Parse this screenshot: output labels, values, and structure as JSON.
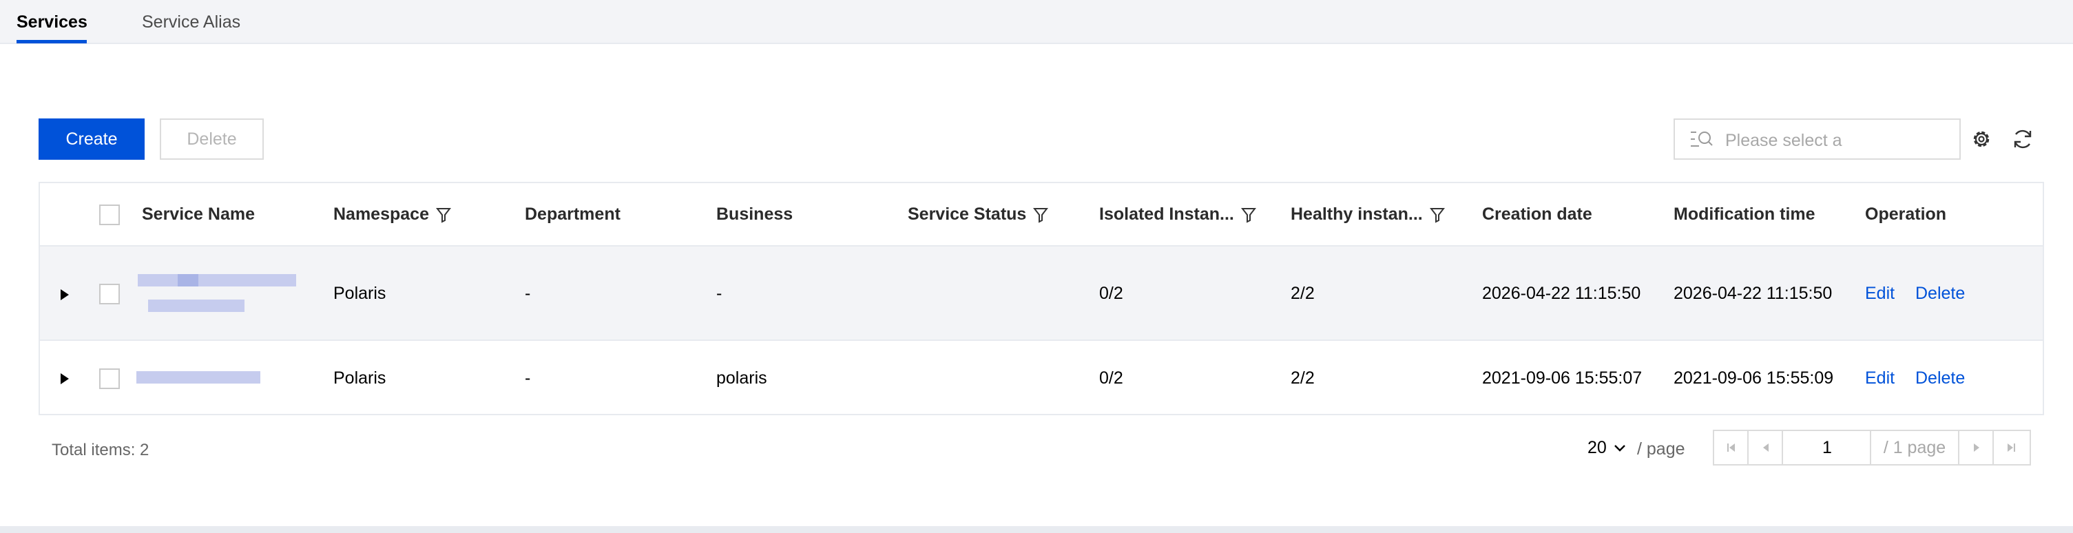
{
  "tabs": [
    {
      "label": "Services",
      "active": true
    },
    {
      "label": "Service Alias",
      "active": false
    }
  ],
  "toolbar": {
    "create_label": "Create",
    "delete_label": "Delete",
    "search_placeholder": "Please select a",
    "icons": [
      "search-icon",
      "gear-icon",
      "refresh-icon"
    ]
  },
  "table": {
    "columns": [
      {
        "label": "Service Name",
        "filter": false
      },
      {
        "label": "Namespace",
        "filter": true
      },
      {
        "label": "Department",
        "filter": false
      },
      {
        "label": "Business",
        "filter": false
      },
      {
        "label": "Service Status",
        "filter": true
      },
      {
        "label": "Isolated Instan...",
        "filter": true
      },
      {
        "label": "Healthy instan...",
        "filter": true
      },
      {
        "label": "Creation date",
        "filter": false
      },
      {
        "label": "Modification time",
        "filter": false
      },
      {
        "label": "Operation",
        "filter": false
      }
    ],
    "rows": [
      {
        "service_name": "",
        "namespace": "Polaris",
        "department": "-",
        "business": "-",
        "service_status": "",
        "isolated_instances": "0/2",
        "healthy_instances": "2/2",
        "creation_date": "2026-04-22 11:15:50",
        "modification_time": "2026-04-22 11:15:50",
        "edit_label": "Edit",
        "delete_label": "Delete"
      },
      {
        "service_name": "",
        "namespace": "Polaris",
        "department": "-",
        "business": "polaris",
        "service_status": "",
        "isolated_instances": "0/2",
        "healthy_instances": "2/2",
        "creation_date": "2021-09-06 15:55:07",
        "modification_time": "2021-09-06 15:55:09",
        "edit_label": "Edit",
        "delete_label": "Delete"
      }
    ]
  },
  "footer": {
    "total_items": "Total items: 2",
    "page_size": "20",
    "per_page_label": "/ page",
    "current_page": "1",
    "total_pages": "/ 1 page"
  },
  "colors": {
    "primary": "#0052d9",
    "tab_bar_bg": "#f3f4f7",
    "row_highlight_bg": "#f3f4f7",
    "border": "#e7eaef",
    "redacted": "#c6ccee"
  }
}
